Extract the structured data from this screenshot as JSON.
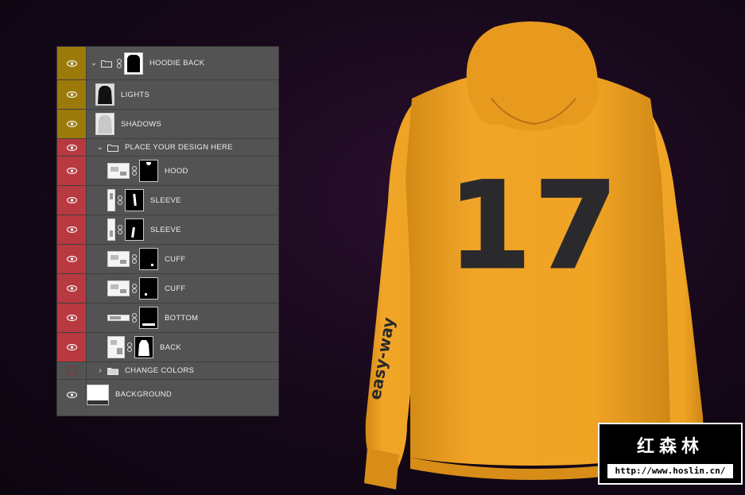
{
  "layers_panel": {
    "layers": [
      {
        "name": "HOODIE BACK",
        "eye": "yellow",
        "type": "group-open",
        "indent": 0
      },
      {
        "name": "LIGHTS",
        "eye": "yellow",
        "type": "layer-dark",
        "indent": 1
      },
      {
        "name": "SHADOWS",
        "eye": "yellow",
        "type": "layer-light",
        "indent": 1
      },
      {
        "name": "PLACE YOUR DESIGN HERE",
        "eye": "red",
        "type": "group-open",
        "indent": 1
      },
      {
        "name": "HOOD",
        "eye": "red",
        "type": "smart-mask",
        "indent": 2
      },
      {
        "name": "SLEEVE",
        "eye": "red",
        "type": "smart-mask",
        "indent": 2
      },
      {
        "name": "SLEEVE",
        "eye": "red",
        "type": "smart-mask",
        "indent": 2
      },
      {
        "name": "CUFF",
        "eye": "red",
        "type": "smart-mask",
        "indent": 2
      },
      {
        "name": "CUFF",
        "eye": "red",
        "type": "smart-mask",
        "indent": 2
      },
      {
        "name": "BOTTOM",
        "eye": "red",
        "type": "smart-mask",
        "indent": 2
      },
      {
        "name": "BACK",
        "eye": "red",
        "type": "smart-mask",
        "indent": 2
      },
      {
        "name": "CHANGE COLORS",
        "eye": "off",
        "type": "group-closed",
        "indent": 1
      },
      {
        "name": "BACKGROUND",
        "eye": "gray",
        "type": "background",
        "indent": 0
      }
    ]
  },
  "hoodie": {
    "number": "17",
    "sleeve_text": "easy-way",
    "color": "#f0a424",
    "print_color": "#2a2a2c"
  },
  "watermark": {
    "title": "红森林",
    "url": "http://www.hoslin.cn/"
  },
  "colors": {
    "eye_yellow": "#9c7a0a",
    "eye_red": "#b8393f",
    "panel_bg": "#535353"
  }
}
